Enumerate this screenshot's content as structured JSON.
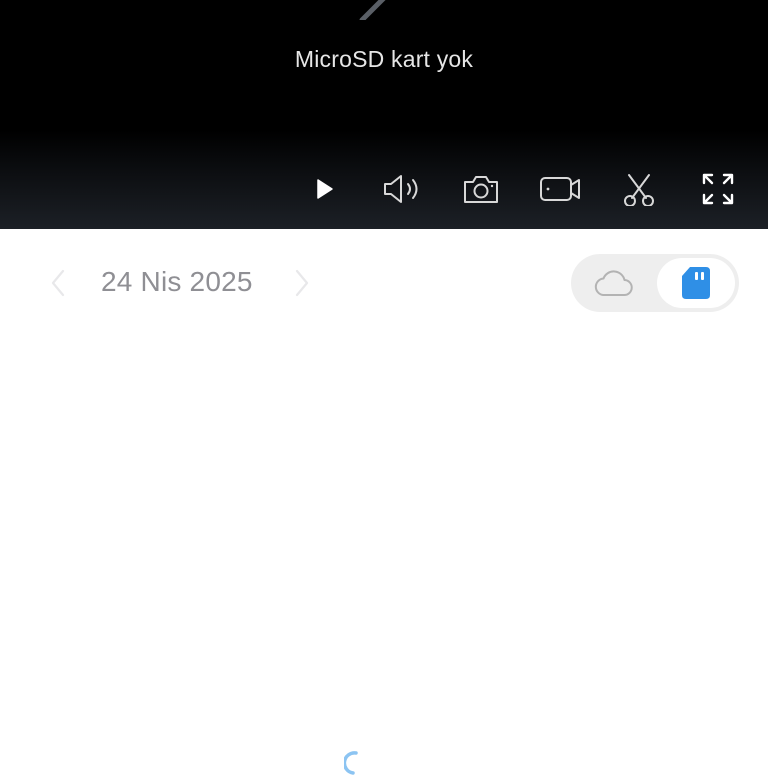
{
  "player": {
    "message": "MicroSD kart yok",
    "controls": [
      {
        "name": "play-icon",
        "icon": "play"
      },
      {
        "name": "volume-icon",
        "icon": "speaker"
      },
      {
        "name": "camera-icon",
        "icon": "snapshot"
      },
      {
        "name": "video-record-icon",
        "icon": "record"
      },
      {
        "name": "scissors-icon",
        "icon": "clip"
      },
      {
        "name": "fullscreen-icon",
        "icon": "expand"
      }
    ]
  },
  "date_bar": {
    "date": "24 Nis 2025",
    "prev_icon": "chevron-left",
    "next_icon": "chevron-right"
  },
  "storage": {
    "options": [
      "cloud",
      "sd-card"
    ],
    "selected": "sd-card"
  },
  "colors": {
    "accent": "#2f8fe6",
    "player_bg": "#000000",
    "muted_text": "#8f8f94",
    "toggle_bg": "#eeeeee"
  }
}
